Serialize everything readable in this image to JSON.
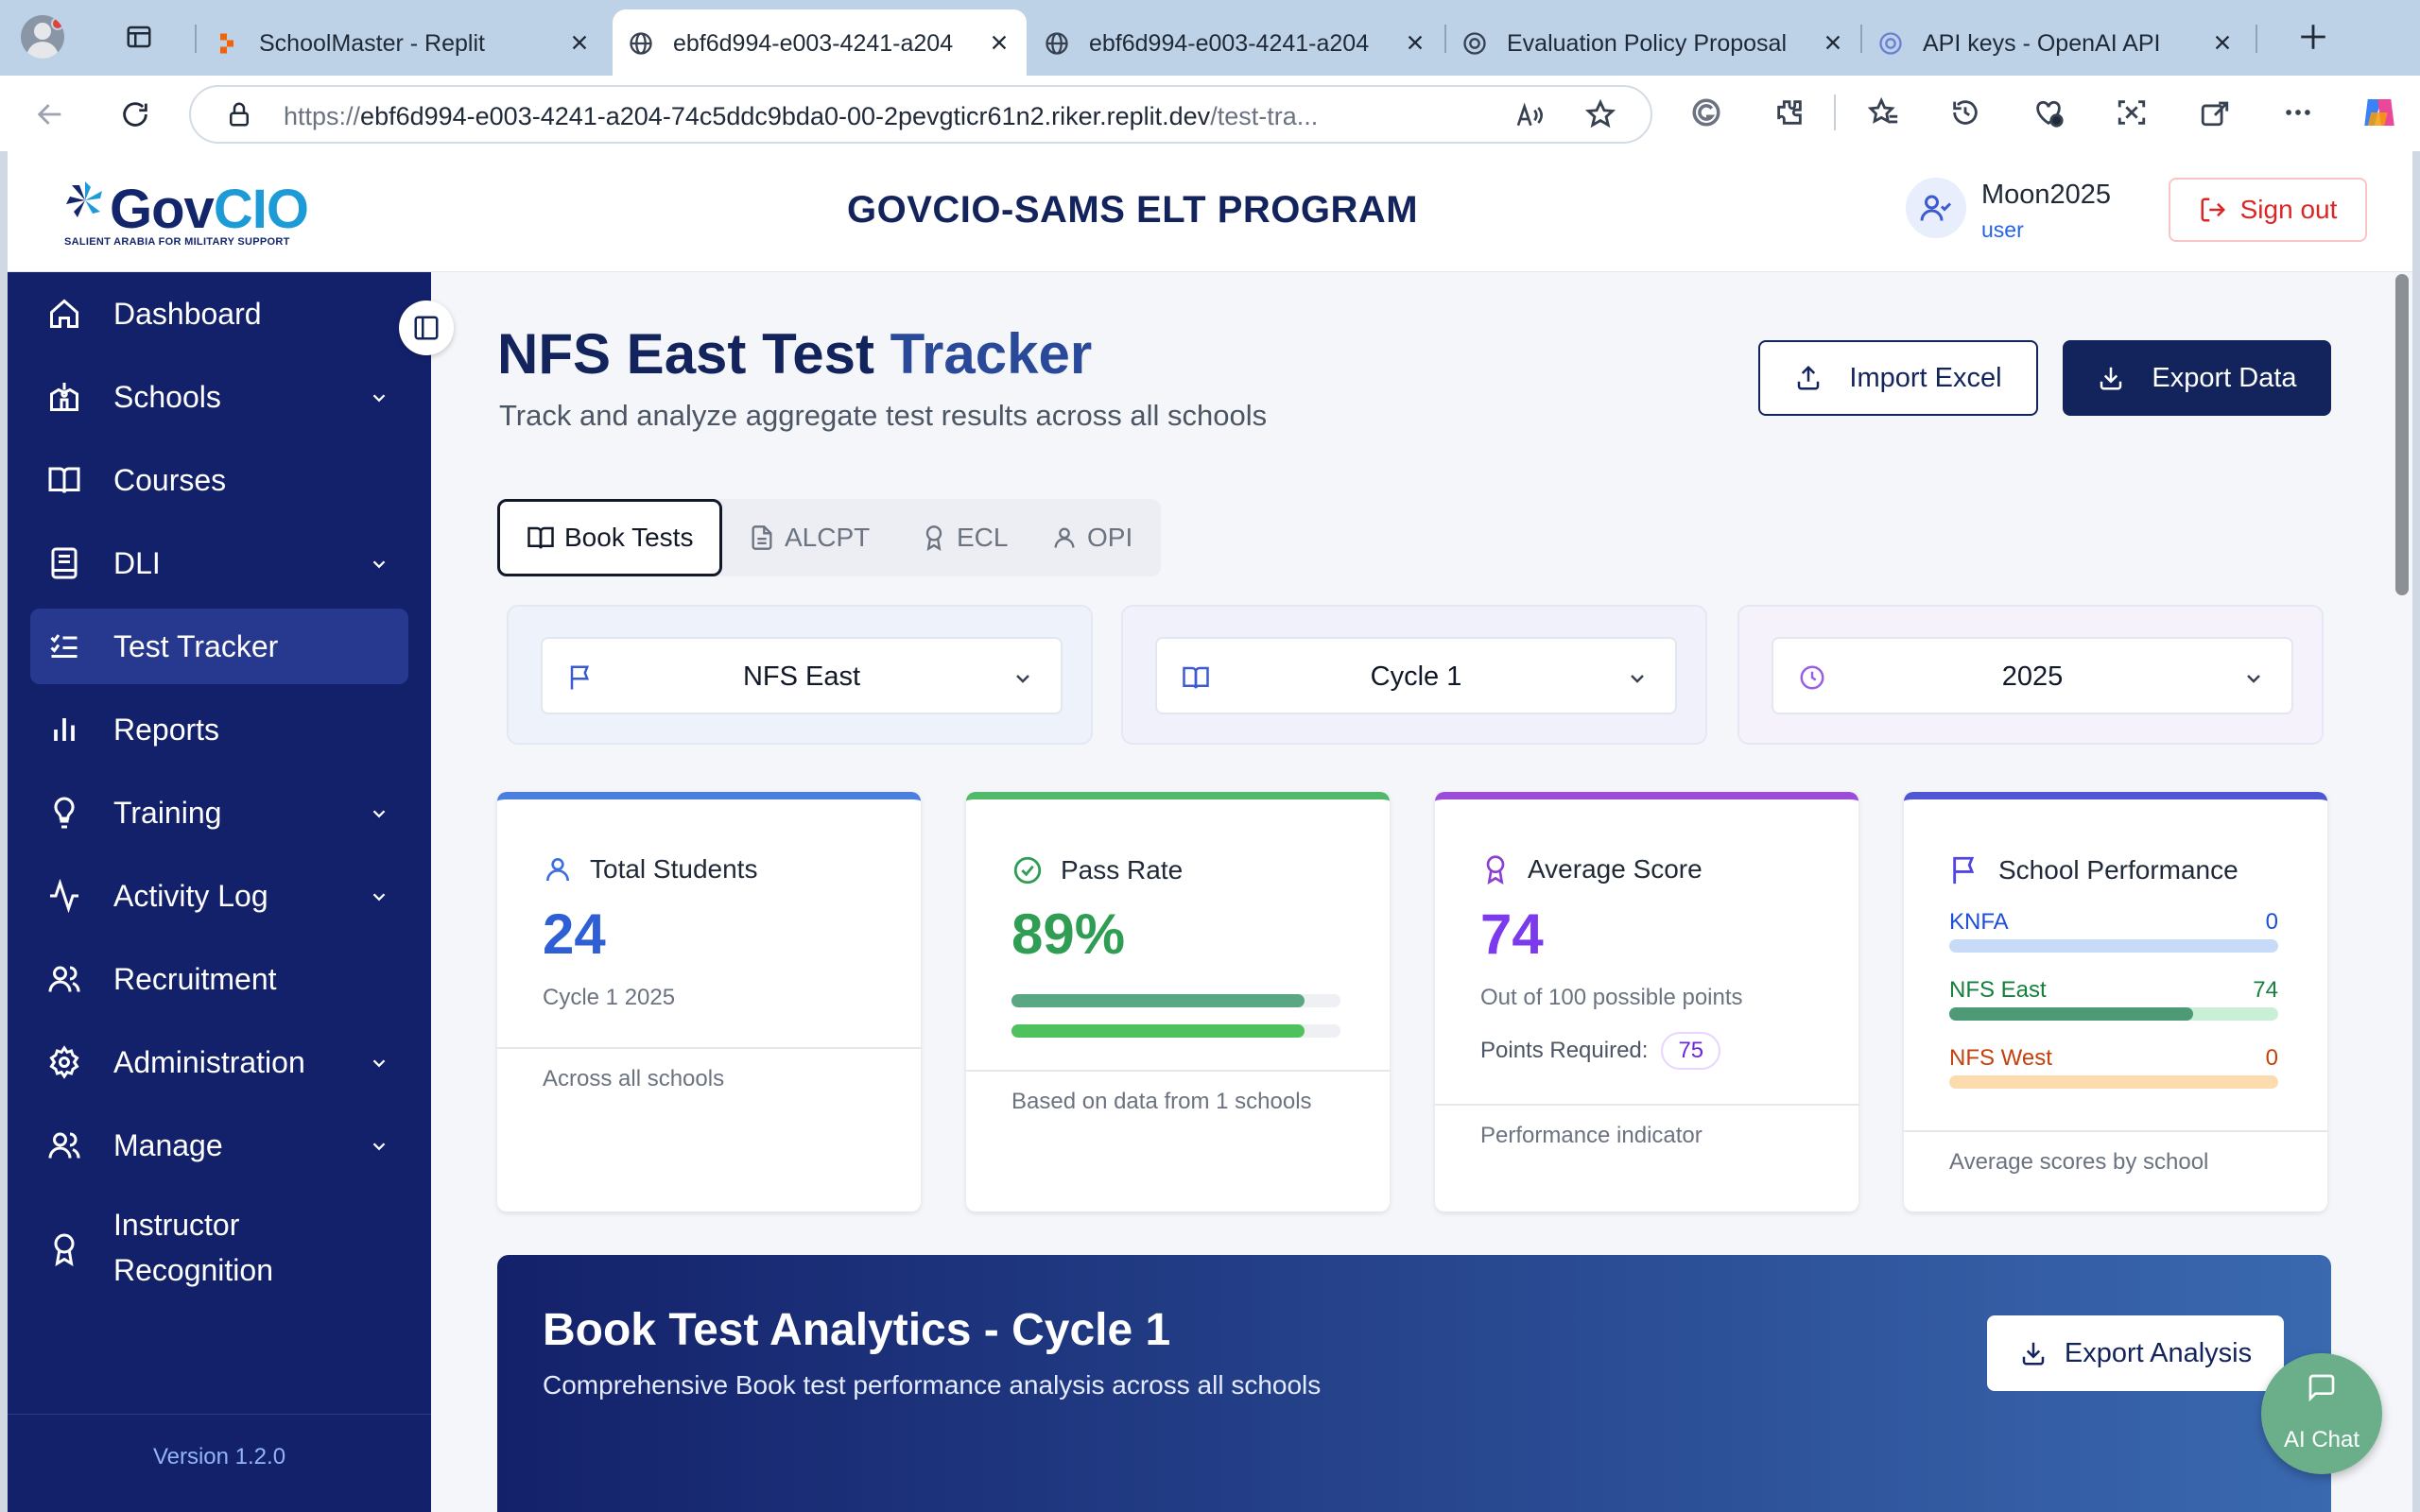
{
  "browser": {
    "tabs": [
      {
        "title": "SchoolMaster - Replit",
        "active": false
      },
      {
        "title": "ebf6d994-e003-4241-a204",
        "active": true
      },
      {
        "title": "ebf6d994-e003-4241-a204",
        "active": false
      },
      {
        "title": "Evaluation Policy Proposal",
        "active": false
      },
      {
        "title": "API keys - OpenAI API",
        "active": false
      }
    ],
    "url_prefix": "https://",
    "url_host": "ebf6d994-e003-4241-a204-74c5ddc9bda0-00-2pevgticr61n2.riker.replit.dev",
    "url_path": "/test-tra..."
  },
  "header": {
    "logo_word_a": "Gov",
    "logo_word_b": "CIO",
    "logo_tagline": "SALIENT ARABIA FOR MILITARY SUPPORT",
    "program_title": "GOVCIO-SAMS ELT PROGRAM",
    "user_name": "Moon2025",
    "user_role": "user",
    "signout_label": "Sign out"
  },
  "sidebar": {
    "items": [
      {
        "label": "Dashboard",
        "icon": "home-icon",
        "expandable": false
      },
      {
        "label": "Schools",
        "icon": "school-icon",
        "expandable": true
      },
      {
        "label": "Courses",
        "icon": "book-open-icon",
        "expandable": false
      },
      {
        "label": "DLI",
        "icon": "book-icon",
        "expandable": true
      },
      {
        "label": "Test Tracker",
        "icon": "list-checks-icon",
        "expandable": false,
        "active": true
      },
      {
        "label": "Reports",
        "icon": "bar-chart-icon",
        "expandable": false
      },
      {
        "label": "Training",
        "icon": "lightbulb-icon",
        "expandable": true
      },
      {
        "label": "Activity Log",
        "icon": "activity-icon",
        "expandable": true
      },
      {
        "label": "Recruitment",
        "icon": "users-icon",
        "expandable": false
      },
      {
        "label": "Administration",
        "icon": "gear-icon",
        "expandable": true
      },
      {
        "label": "Manage",
        "icon": "users-icon",
        "expandable": true
      },
      {
        "label": "Instructor Recognition",
        "label_line1": "Instructor",
        "label_line2": "Recognition",
        "icon": "award-icon",
        "expandable": false
      }
    ],
    "version": "Version 1.2.0"
  },
  "main": {
    "title_a": "NFS East Test",
    "title_b": "Tracker",
    "subtitle": "Track and analyze aggregate test results across all schools",
    "import_label": "Import Excel",
    "export_label": "Export Data",
    "test_tabs": [
      {
        "label": "Book Tests",
        "icon": "book-open-icon",
        "active": true
      },
      {
        "label": "ALCPT",
        "icon": "file-text-icon"
      },
      {
        "label": "ECL",
        "icon": "award-icon"
      },
      {
        "label": "OPI",
        "icon": "user-icon"
      }
    ],
    "filters": {
      "school": "NFS East",
      "cycle": "Cycle 1",
      "year": "2025"
    },
    "cards": {
      "total_students": {
        "label": "Total Students",
        "value": "24",
        "sub": "Cycle 1 2025",
        "foot": "Across all schools"
      },
      "pass_rate": {
        "label": "Pass Rate",
        "value": "89%",
        "fraction": 0.89,
        "foot": "Based on data from 1 schools"
      },
      "average_score": {
        "label": "Average Score",
        "value": "74",
        "sub": "Out of 100 possible points",
        "points_label": "Points Required:",
        "points_value": "75",
        "foot": "Performance indicator"
      },
      "school_performance": {
        "label": "School Performance",
        "schools": [
          {
            "name": "KNFA",
            "value": "0",
            "fraction": 0,
            "color": "#1d4ed8",
            "bar_bg": "#c7dbf8",
            "bar_fill": "#2563eb"
          },
          {
            "name": "NFS East",
            "value": "74",
            "fraction": 0.74,
            "color": "#15803d",
            "bar_bg": "#c9f0d6",
            "bar_fill": "#4f9a76"
          },
          {
            "name": "NFS West",
            "value": "0",
            "fraction": 0,
            "color": "#c2410c",
            "bar_bg": "#fcdcae",
            "bar_fill": "#ea580c"
          }
        ],
        "foot": "Average scores by school"
      }
    },
    "analytics": {
      "title": "Book Test Analytics - Cycle 1",
      "subtitle": "Comprehensive Book test performance analysis across all schools",
      "export_label": "Export Analysis"
    },
    "ai_chat_label": "AI Chat"
  },
  "colors": {
    "navy": "#13235b",
    "sidebar": "#13216a",
    "blue_accent": "#4a7fe0",
    "green_accent": "#52b96a",
    "purple_accent": "#9b4dda",
    "indigo_accent": "#4f56d6"
  }
}
